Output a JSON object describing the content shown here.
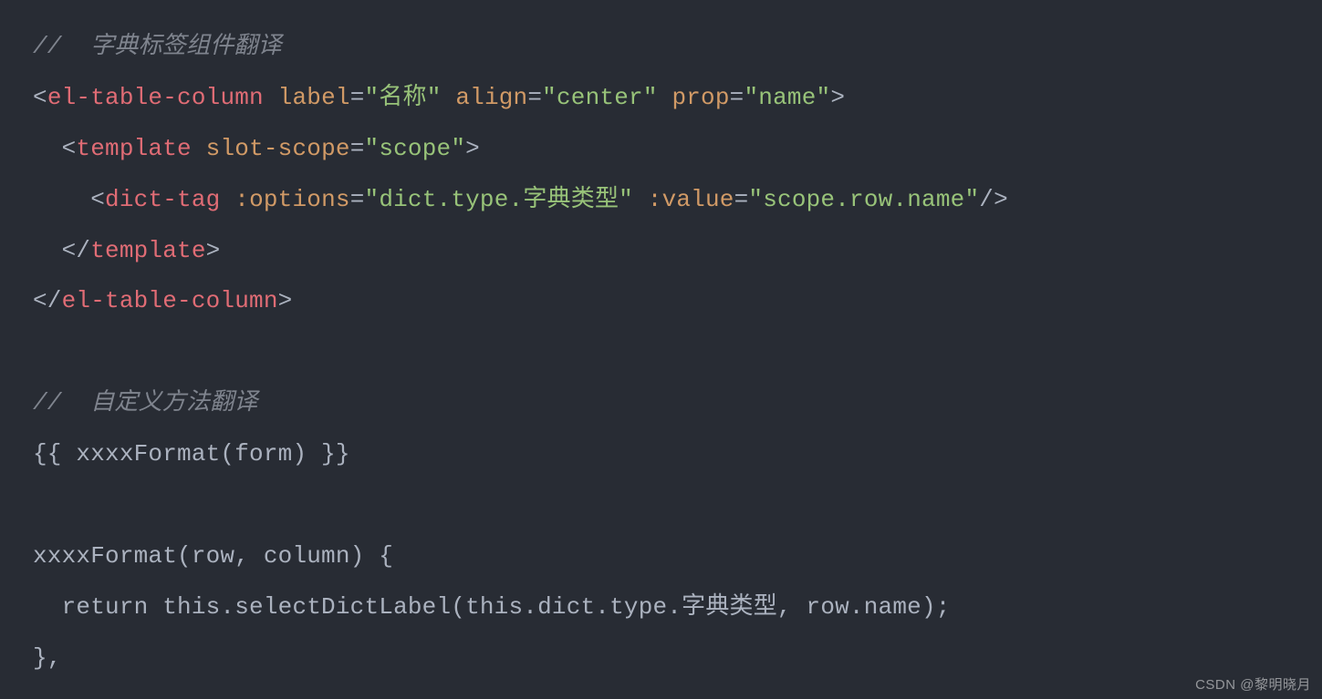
{
  "code": {
    "line1_comment": "//  字典标签组件翻译",
    "line2": {
      "open": "<",
      "tag": "el-table-column",
      "sp1": " ",
      "attr1": "label",
      "eq": "=",
      "q": "\"",
      "val1": "名称",
      "sp2": " ",
      "attr2": "align",
      "val2": "center",
      "sp3": " ",
      "attr3": "prop",
      "val3": "name",
      "close": ">"
    },
    "line3": {
      "indent": "  ",
      "open": "<",
      "tag": "template",
      "sp": " ",
      "attr": "slot-scope",
      "eq": "=",
      "q": "\"",
      "val": "scope",
      "close": ">"
    },
    "line4": {
      "indent": "    ",
      "open": "<",
      "tag": "dict-tag",
      "sp1": " ",
      "attr1": ":options",
      "eq": "=",
      "q": "\"",
      "val1": "dict.type.字典类型",
      "sp2": " ",
      "attr2": ":value",
      "val2": "scope.row.name",
      "selfclose": "/>"
    },
    "line5": {
      "indent": "  ",
      "open": "</",
      "tag": "template",
      "close": ">"
    },
    "line6": {
      "open": "</",
      "tag": "el-table-column",
      "close": ">"
    },
    "line8_comment": "//  自定义方法翻译",
    "line9": "{{ xxxxFormat(form) }}",
    "line11": "xxxxFormat(row, column) {",
    "line12": "  return this.selectDictLabel(this.dict.type.字典类型, row.name);",
    "line13": "},"
  },
  "watermark": "CSDN @黎明晓月"
}
